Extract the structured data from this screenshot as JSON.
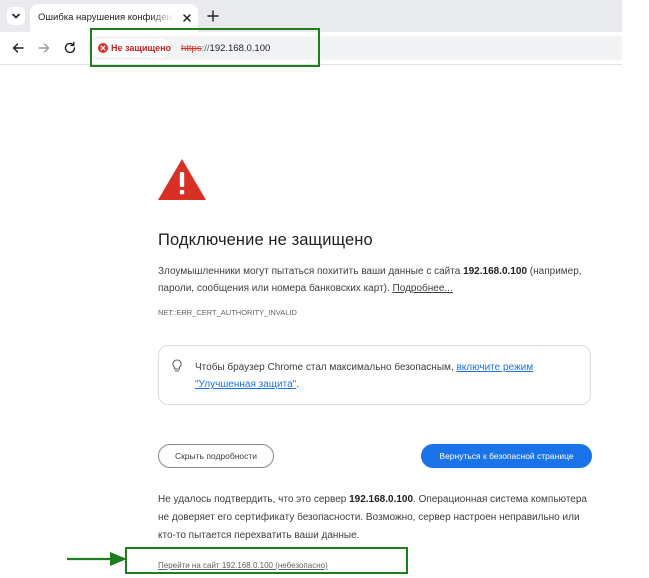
{
  "tab": {
    "title": "Ошибка нарушения конфиденциальности"
  },
  "toolbar": {
    "security_label": "Не защищено",
    "url_scheme": "https",
    "url_sep": "://",
    "url_host": "192.168.0.100"
  },
  "page": {
    "heading": "Подключение не защищено",
    "desc_prefix": "Злоумышленники могут пытаться похитить ваши данные с сайта",
    "desc_host": "192.168.0.100",
    "desc_suffix": "(например, пароли, сообщения или номера банковских карт).",
    "more_link": "Подробнее...",
    "error_code": "NET::ERR_CERT_AUTHORITY_INVALID",
    "tip_prefix": "Чтобы браузер Chrome стал максимально безопасным,",
    "tip_link": "включите режим \"Улучшенная защита\"",
    "tip_suffix": ".",
    "hide_details_button": "Скрыть подробности",
    "back_to_safety_button": "Вернуться к безопасной странице",
    "explain_prefix": "Не удалось подтвердить, что это сервер",
    "explain_host": "192.168.0.100",
    "explain_suffix": ". Операционная система компьютера не доверяет его сертификату безопасности. Возможно, сервер настроен неправильно или кто-то пытается перехватить ваши данные.",
    "proceed_link": "Перейти на сайт 192.168.0.100 (небезопасно)"
  },
  "colors": {
    "accent_blue": "#1a73e8",
    "warning_red": "#d93025",
    "highlight_green": "#1e7d1e"
  }
}
